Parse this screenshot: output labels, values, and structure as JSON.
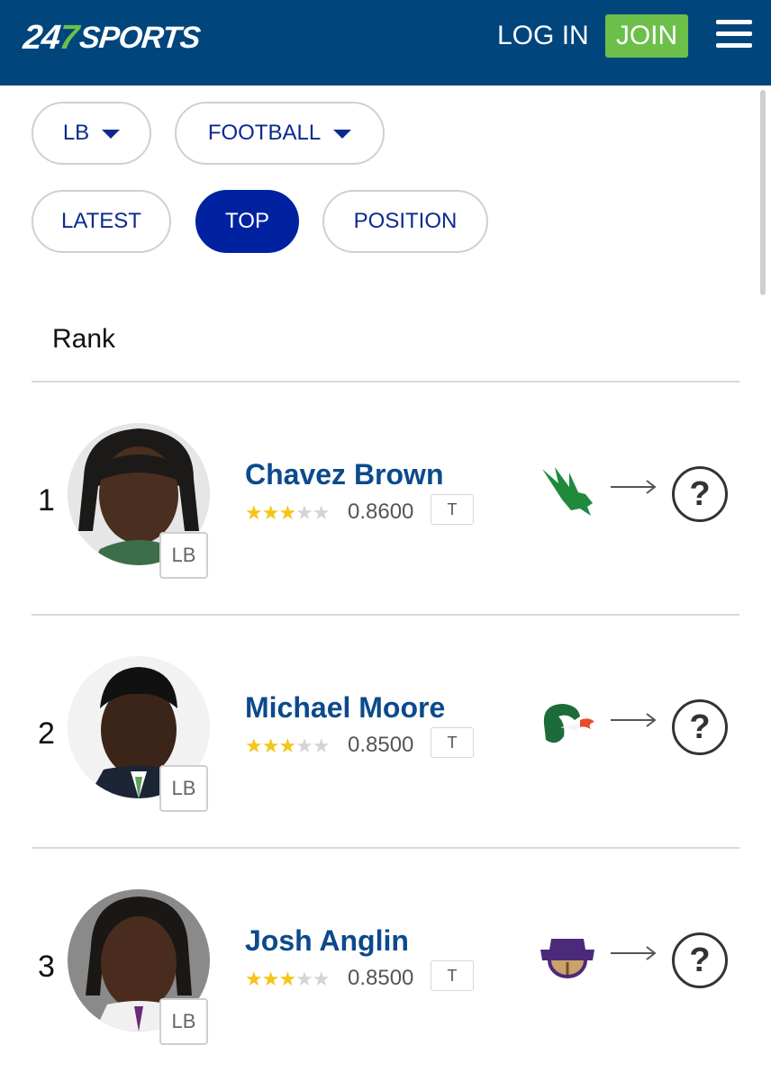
{
  "header": {
    "logo": {
      "digits_a": "24",
      "digit_b": "7",
      "word": "SPORTS"
    },
    "login_label": "LOG IN",
    "join_label": "JOIN",
    "menu_icon": "hamburger-menu-icon",
    "colors": {
      "bar": "#00457c",
      "accent": "#6cc04a"
    }
  },
  "filters": {
    "position_dropdown": "LB",
    "sport_dropdown": "FOOTBALL"
  },
  "tabs": [
    {
      "label": "LATEST",
      "active": false
    },
    {
      "label": "TOP",
      "active": true
    },
    {
      "label": "POSITION",
      "active": false
    }
  ],
  "list": {
    "column_header": "Rank",
    "players": [
      {
        "rank": "1",
        "name": "Chavez Brown",
        "stars_filled": 3,
        "stars_total": 5,
        "rating": "0.8600",
        "badge": "T",
        "position": "LB",
        "from_team_icon": "north-texas-eagle-icon",
        "to_team_icon": "question-mark-icon"
      },
      {
        "rank": "2",
        "name": "Michael Moore",
        "stars_filled": 3,
        "stars_total": 5,
        "rating": "0.8500",
        "badge": "T",
        "position": "LB",
        "from_team_icon": "uab-dragon-icon",
        "to_team_icon": "question-mark-icon"
      },
      {
        "rank": "3",
        "name": "Josh Anglin",
        "stars_filled": 3,
        "stars_total": 5,
        "rating": "0.8500",
        "badge": "T",
        "position": "LB",
        "from_team_icon": "north-alabama-lion-icon",
        "to_team_icon": "question-mark-icon"
      }
    ],
    "arrow_icon": "right-arrow-icon",
    "question_glyph": "?"
  }
}
